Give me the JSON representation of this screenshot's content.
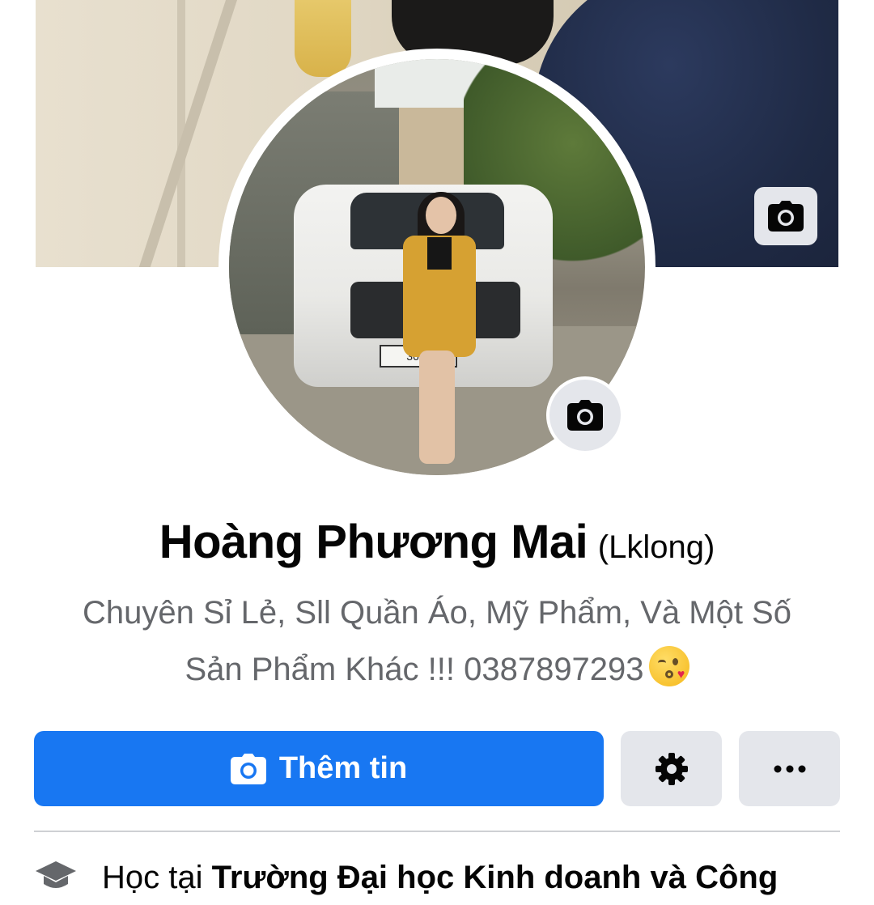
{
  "profile": {
    "name": "Hoàng Phương Mai",
    "alternate_name": "(Lklong)",
    "bio_line1": "Chuyên Sỉ Lẻ, Sll Quần Áo, Mỹ Phẩm, Và Một Số",
    "bio_line2": "Sản Phẩm Khác !!! 0387897293",
    "avatar_plate": "36A-"
  },
  "actions": {
    "add_story_label": "Thêm tin",
    "add_story_icon": "camera-icon",
    "settings_icon": "gear-icon",
    "more_icon": "more-dots-icon"
  },
  "intro": {
    "education_prefix": "Học tại",
    "education_school": "Trường Đại học Kinh doanh và Công",
    "education_icon": "graduation-cap-icon"
  },
  "colors": {
    "primary": "#1877f2",
    "secondary_button": "#e4e6eb",
    "name_text": "#050505",
    "bio_text": "#65676b"
  }
}
